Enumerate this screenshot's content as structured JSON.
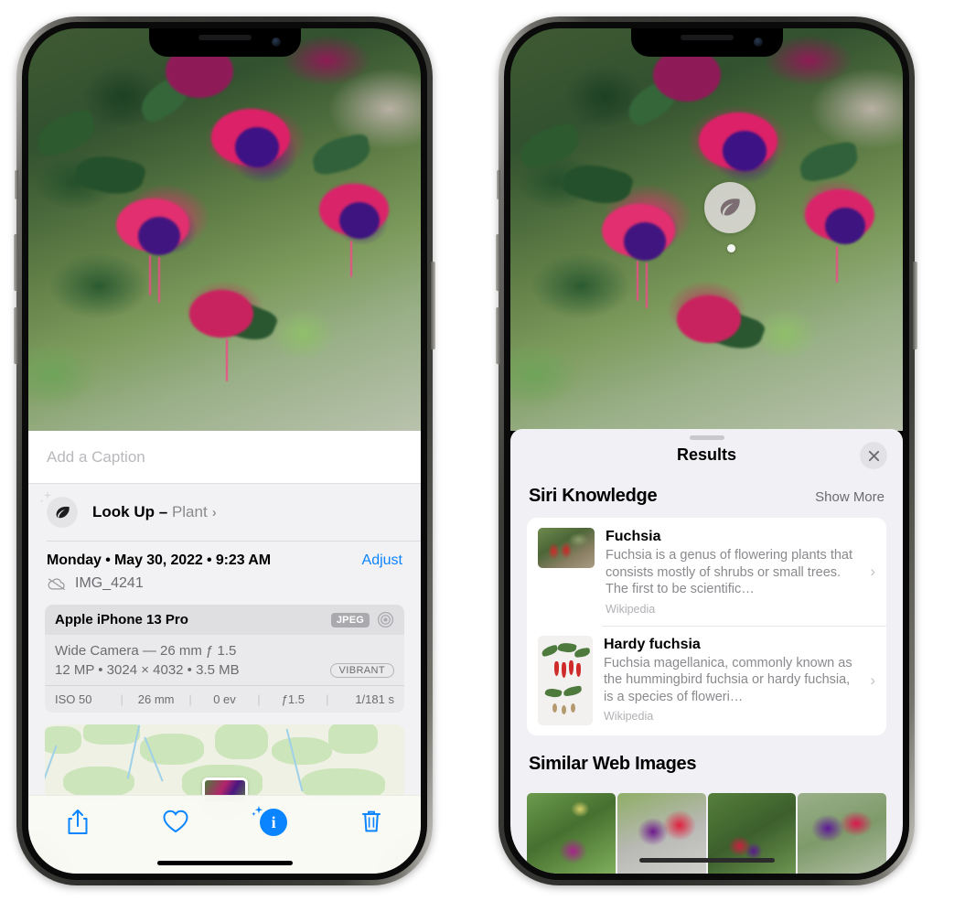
{
  "left_phone": {
    "caption": {
      "placeholder": "Add a Caption",
      "value": ""
    },
    "lookup": {
      "label": "Look Up",
      "separator": "–",
      "subject": "Plant",
      "chevron": "›",
      "icon": "leaf-icon"
    },
    "meta": {
      "date": "Monday • May 30, 2022 • 9:23 AM",
      "adjust_label": "Adjust",
      "filename": "IMG_4241",
      "cloud_icon": "cloud-slash-icon"
    },
    "exif": {
      "device": "Apple iPhone 13 Pro",
      "format_badge": "JPEG",
      "lens_icon": "aperture-icon",
      "line1": "Wide Camera — 26 mm ƒ 1.5",
      "line2": "12 MP • 3024 × 4032 • 3.5 MB",
      "range_badge": "VIBRANT",
      "stats": [
        "ISO 50",
        "26 mm",
        "0 ev",
        "ƒ1.5",
        "1/181 s"
      ]
    },
    "toolbar": [
      {
        "name": "share-button",
        "icon": "share-icon",
        "active": false
      },
      {
        "name": "favorite-button",
        "icon": "heart-icon",
        "active": false
      },
      {
        "name": "info-button",
        "icon": "sparkle-info-icon",
        "active": true
      },
      {
        "name": "delete-button",
        "icon": "trash-icon",
        "active": false
      }
    ]
  },
  "right_phone": {
    "visual_lookup_badge": {
      "icon": "leaf-icon"
    },
    "sheet": {
      "title": "Results",
      "close_icon": "close-icon",
      "sections": [
        {
          "title": "Siri Knowledge",
          "action_label": "Show More",
          "entries": [
            {
              "title": "Fuchsia",
              "description": "Fuchsia is a genus of flowering plants that consists mostly of shrubs or small trees. The first to be scientific…",
              "source": "Wikipedia",
              "chevron": "›"
            },
            {
              "title": "Hardy fuchsia",
              "description": "Fuchsia magellanica, commonly known as the hummingbird fuchsia or hardy fuchsia, is a species of floweri…",
              "source": "Wikipedia",
              "chevron": "›"
            }
          ]
        },
        {
          "title": "Similar Web Images",
          "images": [
            "web-image-1",
            "web-image-2",
            "web-image-3",
            "web-image-4"
          ]
        }
      ]
    }
  },
  "colors": {
    "accent_blue": "#0a84ff",
    "sheet_bg": "#f2f2f4",
    "results_bg": "#f1f0f5",
    "card_bg": "#ffffff",
    "secondary_text": "#8a8a8e",
    "device_frame": "#3b3b38"
  }
}
